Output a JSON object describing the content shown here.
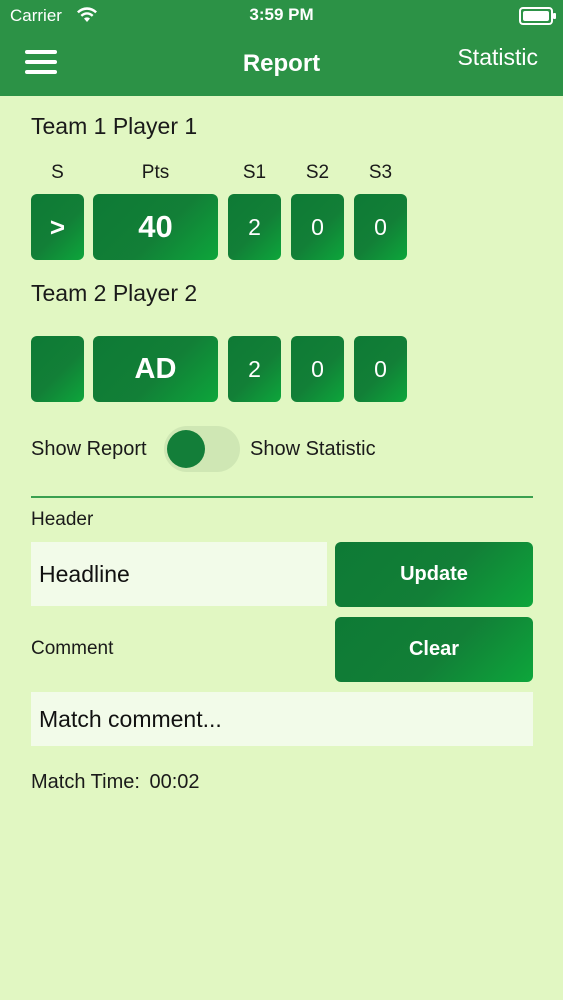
{
  "status": {
    "carrier": "Carrier",
    "time": "3:59 PM"
  },
  "nav": {
    "title": "Report",
    "right_button": "Statistic"
  },
  "score_headers": [
    "S",
    "Pts",
    "S1",
    "S2",
    "S3"
  ],
  "team1": {
    "label": "Team 1 Player 1",
    "serve": ">",
    "points": "40",
    "s1": "2",
    "s2": "0",
    "s3": "0"
  },
  "team2": {
    "label": "Team 2 Player 2",
    "serve": "",
    "points": "AD",
    "s1": "2",
    "s2": "0",
    "s3": "0"
  },
  "toggle": {
    "left_label": "Show Report",
    "right_label": "Show Statistic",
    "state": "Show Report"
  },
  "header_field": {
    "label": "Header",
    "value": "Headline"
  },
  "buttons": {
    "update": "Update",
    "clear": "Clear"
  },
  "comment_field": {
    "label": "Comment",
    "placeholder": "Match comment..."
  },
  "match_time": {
    "label": "Match Time:",
    "value": "00:02"
  },
  "colors": {
    "nav_bar": "#2c9246",
    "background": "#e1f7c2",
    "button": "#127f37"
  }
}
